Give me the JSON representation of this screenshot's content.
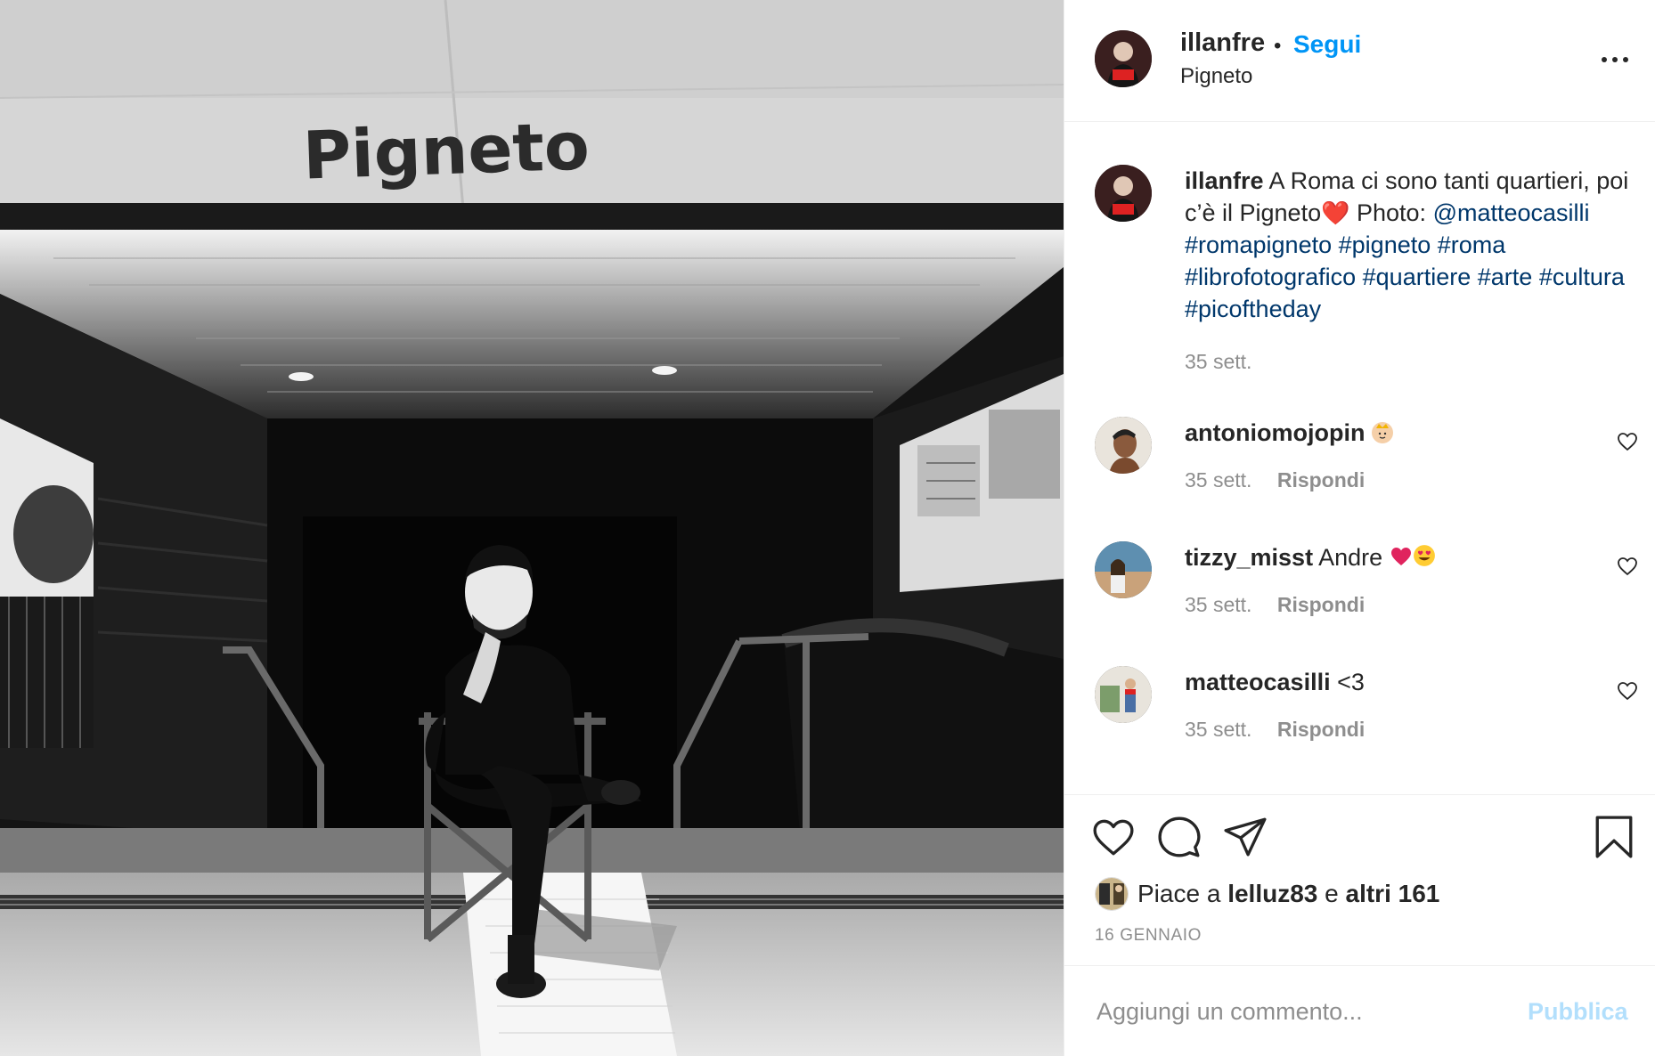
{
  "post": {
    "photo_sign_text": "Pigneto",
    "username": "illanfre",
    "dot": "•",
    "follow_label": "Segui",
    "location": "Pigneto",
    "more_icon": "more-options-icon"
  },
  "caption": {
    "username": "illanfre",
    "text_before_emoji": "A Roma ci sono tanti quartieri, poi c’è il Pigneto",
    "emoji": "❤️",
    "text_after_emoji": "Photo:",
    "mention": "@matteocasilli",
    "hashtags": [
      "#romapigneto",
      "#pigneto",
      "#roma",
      "#librofotografico",
      "#quartiere",
      "#arte",
      "#cultura",
      "#picoftheday"
    ],
    "time": "35 sett."
  },
  "comments": [
    {
      "username": "antoniomojopin",
      "text": "",
      "emoji": "crown-face-emoji",
      "time": "35 sett.",
      "reply_label": "Rispondi"
    },
    {
      "username": "tizzy_misst",
      "text": "Andre",
      "emoji": "heart-and-heart-eyes-emoji",
      "time": "35 sett.",
      "reply_label": "Rispondi"
    },
    {
      "username": "matteocasilli",
      "text": "<3",
      "emoji": "",
      "time": "35 sett.",
      "reply_label": "Rispondi"
    }
  ],
  "actions": {
    "icons": [
      "like-heart-icon",
      "comment-bubble-icon",
      "share-paper-plane-icon",
      "save-bookmark-icon"
    ],
    "likes_prefix": "Piace a",
    "likes_user": "lelluz83",
    "likes_connector": "e",
    "likes_others": "altri 161",
    "date": "16 GENNAIO"
  },
  "add_comment": {
    "placeholder": "Aggiungi un commento...",
    "publish_label": "Pubblica"
  },
  "colors": {
    "link_blue": "#0095f6",
    "hashtag_blue": "#00376b",
    "secondary_grey": "#8e8e8e",
    "publish_disabled": "#b2dffc"
  }
}
